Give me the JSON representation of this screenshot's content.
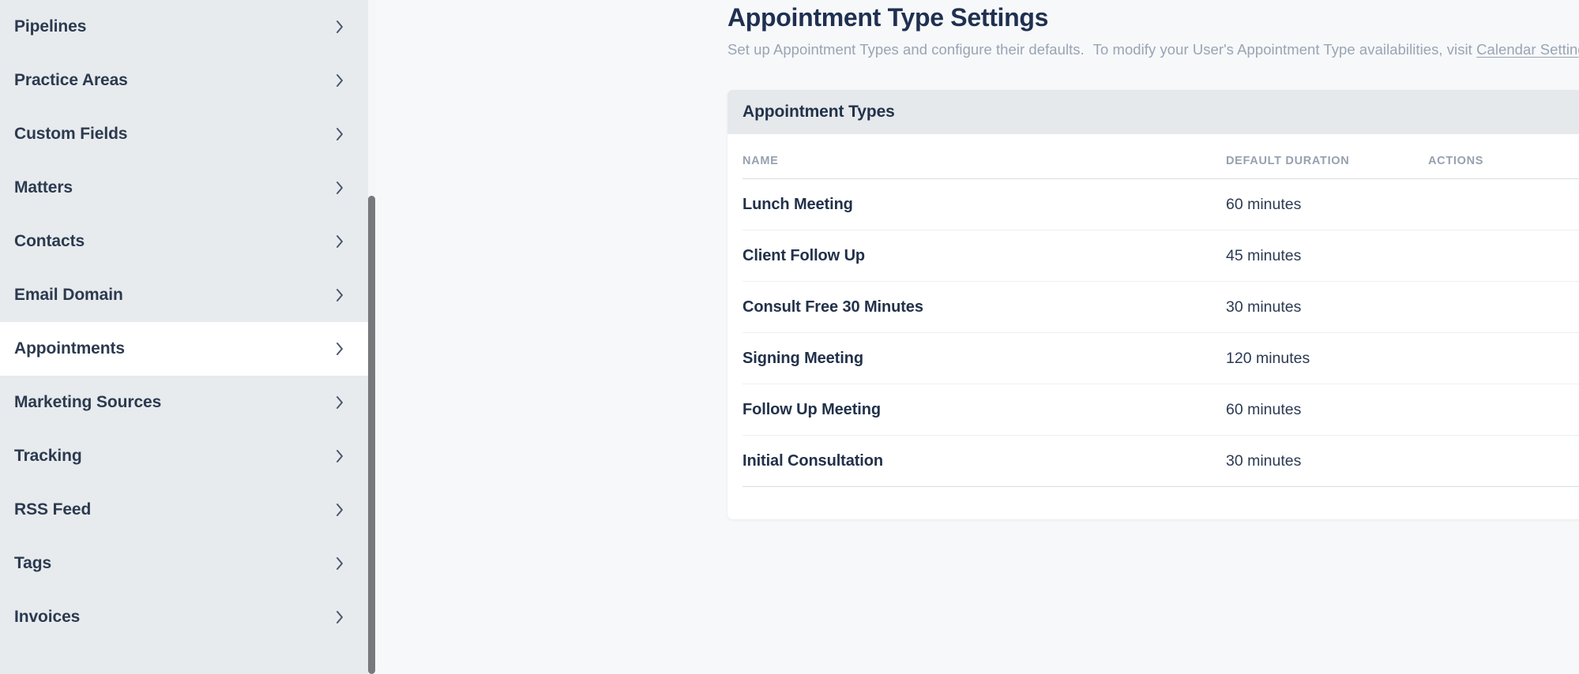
{
  "sidebar": {
    "items": [
      {
        "label": "Pipelines",
        "active": false
      },
      {
        "label": "Practice Areas",
        "active": false
      },
      {
        "label": "Custom Fields",
        "active": false
      },
      {
        "label": "Matters",
        "active": false
      },
      {
        "label": "Contacts",
        "active": false
      },
      {
        "label": "Email Domain",
        "active": false
      },
      {
        "label": "Appointments",
        "active": true
      },
      {
        "label": "Marketing Sources",
        "active": false
      },
      {
        "label": "Tracking",
        "active": false
      },
      {
        "label": "RSS Feed",
        "active": false
      },
      {
        "label": "Tags",
        "active": false
      },
      {
        "label": "Invoices",
        "active": false
      }
    ]
  },
  "header": {
    "title": "Appointment Type Settings",
    "subtitle_part1": "Set up Appointment Types and configure their defaults.",
    "subtitle_part2": "To modify your User's Appointment Type availabilities, visit",
    "subtitle_link": "Calendar Settings.",
    "link_color": "#9aa4b4"
  },
  "card": {
    "title": "Appointment Types",
    "columns": {
      "name": "NAME",
      "duration": "DEFAULT DURATION",
      "actions": "ACTIONS"
    },
    "rows": [
      {
        "name": "Lunch Meeting",
        "duration": "60 minutes",
        "actions": [
          "share-icon",
          "edit-icon",
          "delete-icon"
        ]
      },
      {
        "name": "Client Follow Up",
        "duration": "45 minutes",
        "actions": [
          "share-icon",
          "edit-icon",
          "delete-icon"
        ]
      },
      {
        "name": "Consult Free 30 Minutes",
        "duration": "30 minutes",
        "actions": [
          "share-icon",
          "edit-icon",
          "delete-icon"
        ]
      },
      {
        "name": "Signing Meeting",
        "duration": "120 minutes",
        "actions": [
          "share-icon",
          "edit-icon",
          "delete-icon"
        ]
      },
      {
        "name": "Follow Up Meeting",
        "duration": "60 minutes",
        "actions": [
          "share-icon",
          "edit-icon",
          "delete-icon"
        ]
      },
      {
        "name": "Initial Consultation",
        "duration": "30 minutes",
        "actions": [
          "share-icon",
          "edit-icon"
        ]
      }
    ]
  },
  "theme": {
    "sidebar_bg": "#e7ebee",
    "active_item_bg": "#ffffff",
    "page_bg": "#f6f8fa",
    "card_header_bg": "#e5e9ec",
    "text_dark": "#22314a",
    "text_muted": "#97a0b0",
    "scrollbar_thumb": "#77797c"
  }
}
